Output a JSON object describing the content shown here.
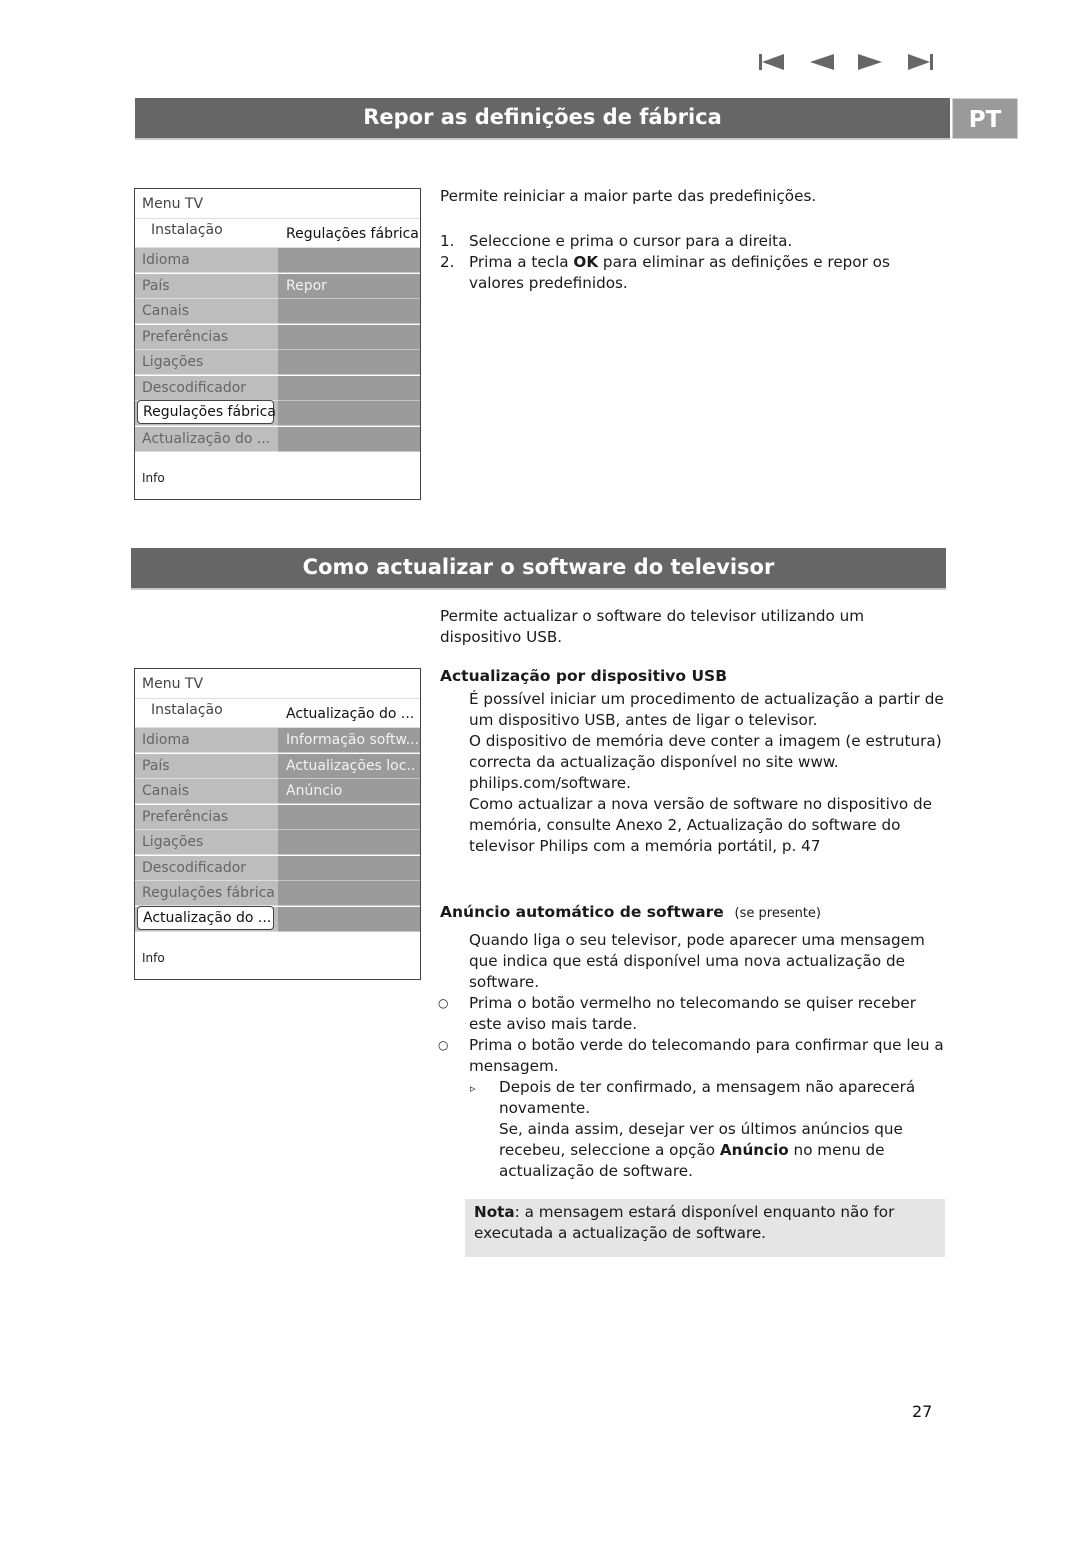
{
  "nav": {
    "icons": [
      "skip-to-start-icon",
      "previous-icon",
      "next-icon",
      "skip-to-end-icon"
    ],
    "color": "#666666"
  },
  "language_tab": "PT",
  "colors": {
    "header_bar": "#666666",
    "lang_tab": "#9a9a9a",
    "note_bg": "#e5e5e5"
  },
  "section1": {
    "title": "Repor as definições de fábrica",
    "menu": {
      "title": "Menu TV",
      "submenu_left": "Instalação",
      "submenu_right": "Regulações fábrica",
      "items": [
        "Idioma",
        "País",
        "Canais",
        "Preferências",
        "Ligações",
        "Descodificador",
        "Regulações fábrica",
        "Actualização do ..."
      ],
      "selected": "Regulações fábrica",
      "right_items": [
        "",
        "Repor",
        "",
        "",
        "",
        "",
        "",
        ""
      ],
      "info": "Info"
    },
    "intro": "Permite reiniciar a maior parte das predefinições.",
    "steps": [
      {
        "num": "1.",
        "text": "Seleccione e prima o cursor para a direita."
      },
      {
        "num": "2.",
        "pre": "Prima a tecla ",
        "bold": "OK",
        "post": " para eliminar as definições e repor os valores predefinidos."
      }
    ]
  },
  "section2": {
    "title": "Como actualizar o software do televisor",
    "menu": {
      "title": "Menu TV",
      "submenu_left": "Instalação",
      "submenu_right": "Actualização do ...",
      "items": [
        "Idioma",
        "País",
        "Canais",
        "Preferências",
        "Ligações",
        "Descodificador",
        "Regulações fábrica",
        "Actualização do ..."
      ],
      "selected": "Actualização do ...",
      "right_items": [
        "Informação softw...",
        "Actualizações loc..",
        "Anúncio",
        "",
        "",
        "",
        "",
        ""
      ],
      "info": "Info"
    },
    "intro": "Permite actualizar o software do televisor utilizando um dispositivo USB.",
    "usb": {
      "heading": "Actualização por dispositivo USB",
      "p1": "É possível iniciar um procedimento de actualização a partir de um dispositivo USB, antes de ligar o televisor.",
      "p2": "O dispositivo de memória deve conter a imagem (e estrutura) correcta da actualização disponível no site www. philips.com/software.",
      "p3": "Como actualizar a nova versão de software no dispositivo de memória, consulte Anexo 2, Actualização do software do televisor Philips com a memória portátil, p. 47"
    },
    "auto": {
      "heading": "Anúncio automático de software",
      "heading_note": "(se presente)",
      "p1": "Quando liga o seu televisor, pode aparecer uma mensagem que indica que está disponível uma nova actualização de software.",
      "bullet1": "Prima o botão vermelho no telecomando se quiser receber este aviso mais tarde.",
      "bullet2": "Prima o botão verde do telecomando para confirmar que leu a mensagem.",
      "sub1": "Depois de ter confirmado, a mensagem não aparecerá novamente.",
      "sub2_pre": "Se, ainda assim, desejar ver os últimos anúncios que recebeu, seleccione a opção ",
      "sub2_bold": "Anúncio",
      "sub2_post": " no menu de actualização de software."
    },
    "note": {
      "label": "Nota",
      "text": ": a mensagem estará disponível enquanto não for executada a actualização de software."
    }
  },
  "page_number": "27"
}
